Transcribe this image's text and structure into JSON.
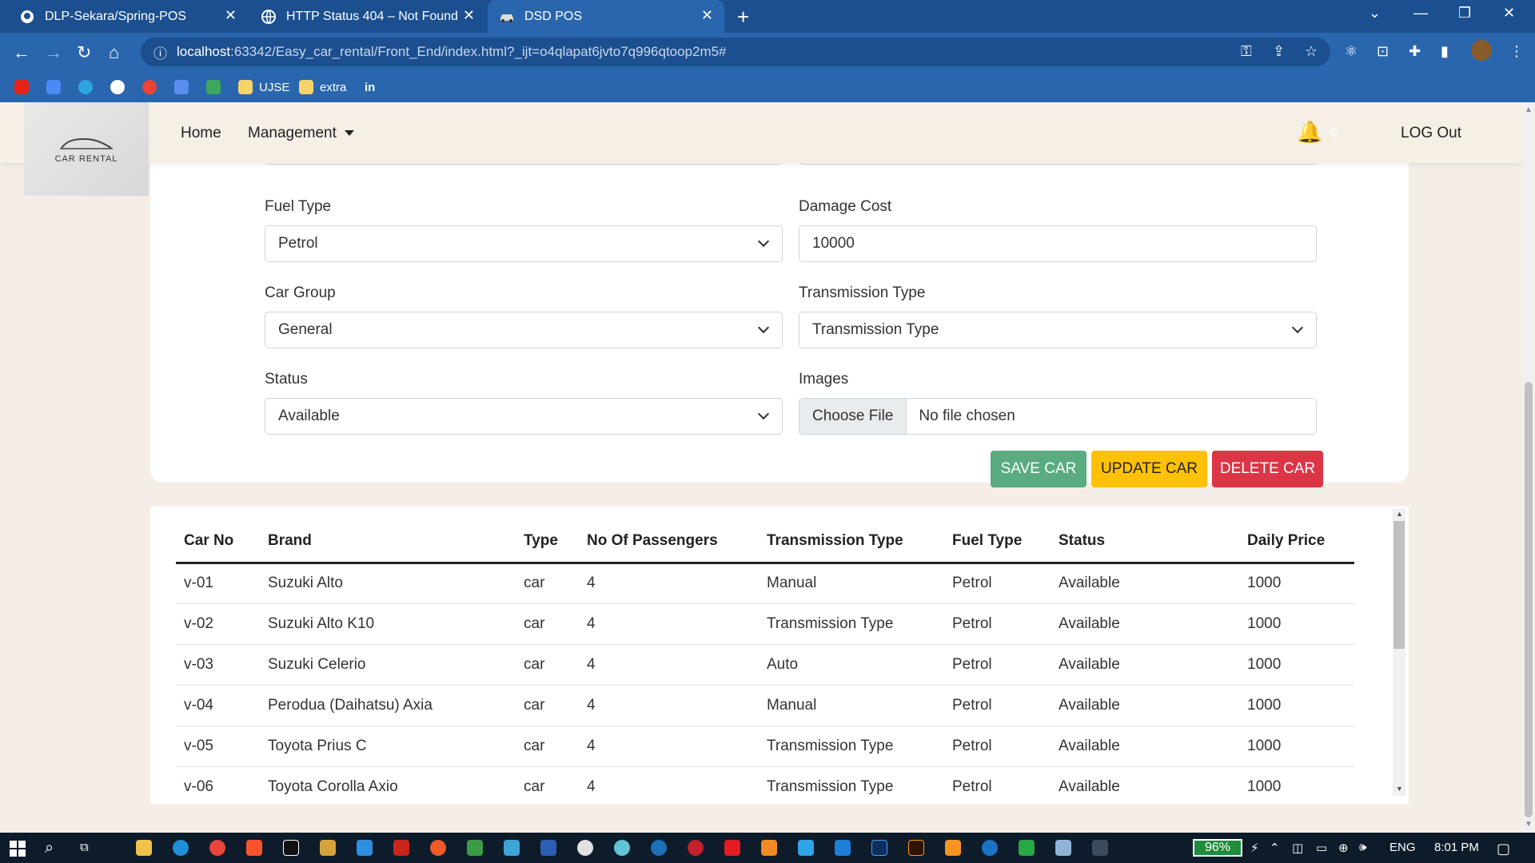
{
  "browser": {
    "tabs": [
      {
        "title": "DLP-Sekara/Spring-POS",
        "icon": "github-icon"
      },
      {
        "title": "HTTP Status 404 – Not Found",
        "icon": "globe-icon"
      },
      {
        "title": "DSD POS",
        "icon": "car-icon"
      }
    ],
    "url_host": "localhost",
    "url_rest": ":63342/Easy_car_rental/Front_End/index.html?_ijt=o4qlapat6jvto7q996qtoop2m5#",
    "bookmarks": [
      {
        "label": "UJSE",
        "icon": "folder-icon"
      },
      {
        "label": "extra",
        "icon": "folder-icon"
      },
      {
        "label": "in",
        "icon": "linkedin-icon"
      }
    ]
  },
  "navbar": {
    "logo_text": "CAR RENTAL",
    "home": "Home",
    "management": "Management",
    "notification_count": "0",
    "logout": "LOG Out"
  },
  "form": {
    "fuel_type_label": "Fuel Type",
    "fuel_type_value": "Petrol",
    "damage_cost_label": "Damage Cost",
    "damage_cost_value": "10000",
    "car_group_label": "Car Group",
    "car_group_value": "General",
    "transmission_label": "Transmission Type",
    "transmission_value": "Transmission Type",
    "status_label": "Status",
    "status_value": "Available",
    "images_label": "Images",
    "file_button": "Choose File",
    "file_text": "No file chosen",
    "save_btn": "SAVE CAR",
    "update_btn": "UPDATE CAR",
    "delete_btn": "DELETE CAR"
  },
  "table": {
    "headers": [
      "Car No",
      "Brand",
      "Type",
      "No Of Passengers",
      "Transmission Type",
      "Fuel Type",
      "Status",
      "Daily Price"
    ],
    "rows": [
      [
        "v-01",
        "Suzuki Alto",
        "car",
        "4",
        "Manual",
        "Petrol",
        "Available",
        "1000"
      ],
      [
        "v-02",
        "Suzuki Alto K10",
        "car",
        "4",
        "Transmission Type",
        "Petrol",
        "Available",
        "1000"
      ],
      [
        "v-03",
        "Suzuki Celerio",
        "car",
        "4",
        "Auto",
        "Petrol",
        "Available",
        "1000"
      ],
      [
        "v-04",
        "Perodua (Daihatsu) Axia",
        "car",
        "4",
        "Manual",
        "Petrol",
        "Available",
        "1000"
      ],
      [
        "v-05",
        "Toyota Prius C",
        "car",
        "4",
        "Transmission Type",
        "Petrol",
        "Available",
        "1000"
      ],
      [
        "v-06",
        "Toyota Corolla Axio",
        "car",
        "4",
        "Transmission Type",
        "Petrol",
        "Available",
        "1000"
      ]
    ]
  },
  "taskbar": {
    "battery": "96%",
    "language": "ENG",
    "time": "8:01 PM"
  },
  "colors": {
    "save": "#5aab80",
    "update": "#ffc107",
    "delete": "#dc3545",
    "chrome_dark": "#1b4f8f",
    "chrome_light": "#2a66ad"
  }
}
